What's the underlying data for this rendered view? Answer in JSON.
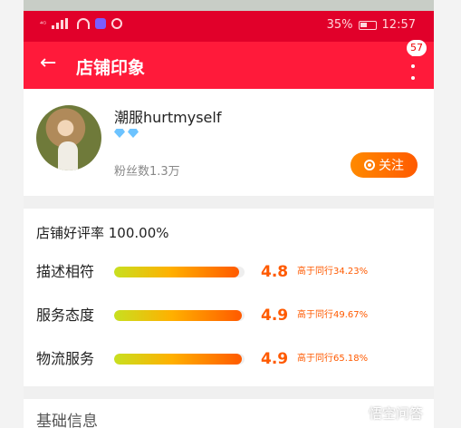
{
  "status_bar": {
    "signal": "⁴ᴳ",
    "battery": "35%",
    "time": "12:57"
  },
  "app_bar": {
    "back": "←",
    "title": "店铺印象",
    "more_badge": "57"
  },
  "profile": {
    "shop_name": "潮服hurtmyself",
    "diamond_count": 2,
    "fans": "粉丝数1.3万",
    "follow_label": "关注"
  },
  "ratings": {
    "heading": "店铺好评率 100.00%",
    "rows": [
      {
        "label": "描述相符",
        "score": "4.8",
        "compare": "高于同行34.23%",
        "fill_fraction": 0.96
      },
      {
        "label": "服务态度",
        "score": "4.9",
        "compare": "高于同行49.67%",
        "fill_fraction": 0.98
      },
      {
        "label": "物流服务",
        "score": "4.9",
        "compare": "高于同行65.18%",
        "fill_fraction": 0.98
      }
    ]
  },
  "basic_info": {
    "title": "基础信息"
  },
  "watermark": {
    "text": "悟空问答"
  },
  "colors": {
    "status_bar": "#e1002a",
    "app_bar": "#ff1a3a",
    "accent": "#ff5a00"
  }
}
